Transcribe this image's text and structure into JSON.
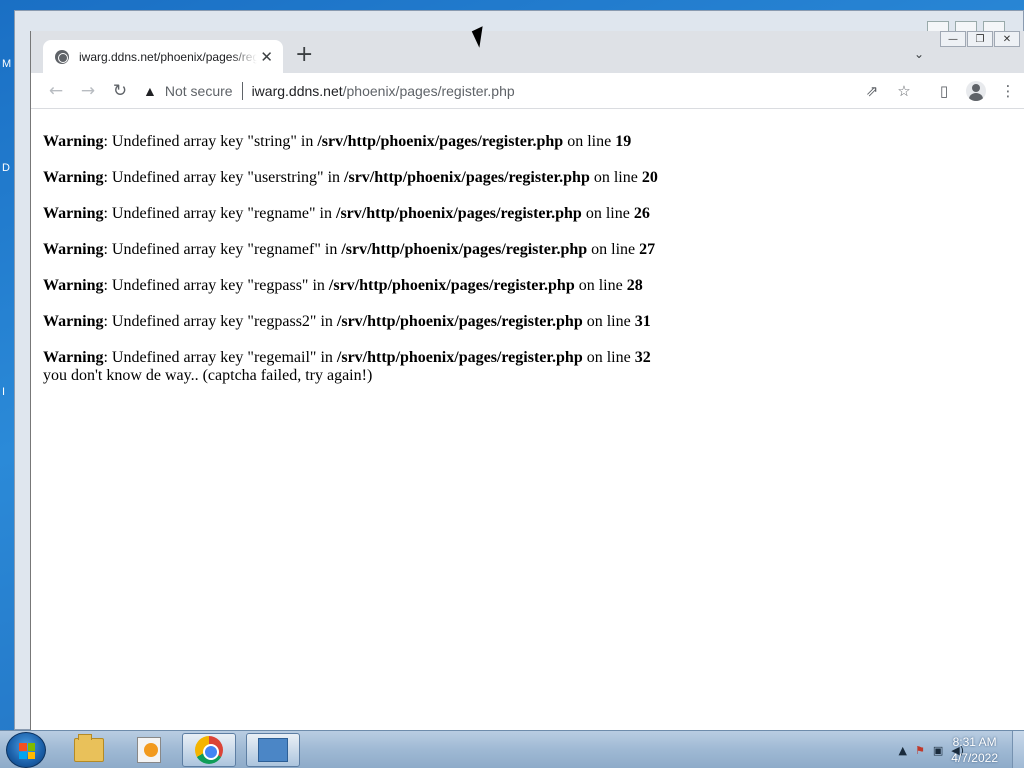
{
  "desktop": {
    "edge_letters": [
      "M",
      "D",
      "I"
    ]
  },
  "browser": {
    "tab": {
      "title": "iwarg.ddns.net/phoenix/pages/register.php",
      "close_glyph": "✕",
      "new_tab_glyph": "+"
    },
    "window_controls": {
      "minimize": "—",
      "restore": "❐",
      "close": "✕"
    },
    "toolbar": {
      "security_label": "Not secure",
      "url_host": "iwarg.ddns.net",
      "url_path": "/phoenix/pages/register.php",
      "back_glyph": "←",
      "forward_glyph": "→",
      "reload_glyph": "↻",
      "share_glyph": "⇗",
      "star_glyph": "☆",
      "sidepanel_glyph": "▯",
      "menu_glyph": "⋮"
    }
  },
  "page": {
    "warnings": [
      {
        "label": "Warning",
        "text": ": Undefined array key \"string\" in ",
        "path": "/srv/http/phoenix/pages/register.php",
        "on": " on line ",
        "line": "19"
      },
      {
        "label": "Warning",
        "text": ": Undefined array key \"userstring\" in ",
        "path": "/srv/http/phoenix/pages/register.php",
        "on": " on line ",
        "line": "20"
      },
      {
        "label": "Warning",
        "text": ": Undefined array key \"regname\" in ",
        "path": "/srv/http/phoenix/pages/register.php",
        "on": " on line ",
        "line": "26"
      },
      {
        "label": "Warning",
        "text": ": Undefined array key \"regnamef\" in ",
        "path": "/srv/http/phoenix/pages/register.php",
        "on": " on line ",
        "line": "27"
      },
      {
        "label": "Warning",
        "text": ": Undefined array key \"regpass\" in ",
        "path": "/srv/http/phoenix/pages/register.php",
        "on": " on line ",
        "line": "28"
      },
      {
        "label": "Warning",
        "text": ": Undefined array key \"regpass2\" in ",
        "path": "/srv/http/phoenix/pages/register.php",
        "on": " on line ",
        "line": "31"
      },
      {
        "label": "Warning",
        "text": ": Undefined array key \"regemail\" in ",
        "path": "/srv/http/phoenix/pages/register.php",
        "on": " on line ",
        "line": "32"
      }
    ],
    "message": "you don't know de way.. (captcha failed, try again!)"
  },
  "taskbar": {
    "apps": [
      "folder-icon",
      "media-player-icon",
      "chrome-icon",
      "remote-desktop-icon"
    ],
    "tray_arrow": "▲",
    "time": "8:31 AM",
    "date": "4/7/2022"
  }
}
